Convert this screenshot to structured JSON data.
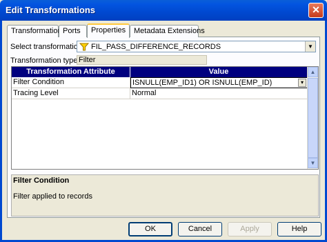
{
  "window": {
    "title": "Edit Transformations",
    "close_glyph": "✕"
  },
  "tabs": [
    {
      "label": "Transformation"
    },
    {
      "label": "Ports"
    },
    {
      "label": "Properties"
    },
    {
      "label": "Metadata Extensions"
    }
  ],
  "properties": {
    "select_label": "Select transformation:",
    "selected_transformation": "FIL_PASS_DIFFERENCE_RECORDS",
    "type_label": "Transformation type:",
    "type_value": "Filter"
  },
  "grid": {
    "columns": [
      "Transformation Attribute",
      "Value"
    ],
    "rows": [
      {
        "attribute": "Filter Condition",
        "value": "ISNULL(EMP_ID1) OR ISNULL(EMP_ID)"
      },
      {
        "attribute": "Tracing Level",
        "value": "Normal"
      }
    ]
  },
  "description": {
    "title": "Filter Condition",
    "text": "Filter applied to records"
  },
  "buttons": {
    "ok": "OK",
    "cancel": "Cancel",
    "apply": "Apply",
    "help": "Help"
  },
  "icons": {
    "filter": "filter-funnel-icon",
    "dropdown": "chevron-down-icon",
    "edit": "edit-expression-icon"
  },
  "colors": {
    "title_bar": "#0048d0",
    "grid_header": "#00007f",
    "active_tab_accent": "#ffc83c"
  }
}
